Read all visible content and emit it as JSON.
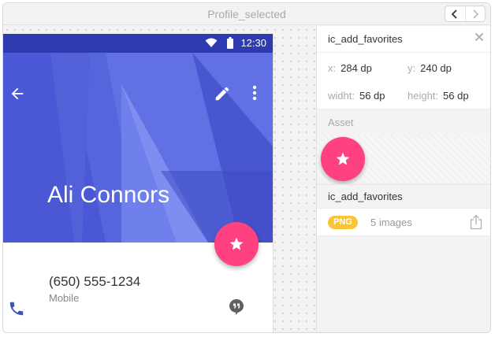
{
  "window": {
    "title": "Profile_selected"
  },
  "nav": {
    "back_icon": "chevron-left-icon",
    "forward_icon": "chevron-right-icon"
  },
  "phone": {
    "status_bar": {
      "time": "12:30",
      "color": "#2e3bb0"
    },
    "hero": {
      "name": "Ali Connors",
      "color": "#4a58d6",
      "icons": [
        "arrow-back-icon",
        "edit-icon",
        "more-vert-icon"
      ]
    },
    "fab": {
      "icon": "star-icon",
      "color": "#ff4081"
    },
    "contact": {
      "number": "(650) 555-1234",
      "label": "Mobile",
      "icons": [
        "phone-icon",
        "chat-icon"
      ]
    }
  },
  "inspector": {
    "asset_name": "ic_add_favorites",
    "x": {
      "label": "x:",
      "value": "284 dp"
    },
    "y": {
      "label": "y:",
      "value": "240 dp"
    },
    "width": {
      "label": "widht:",
      "value": "56 dp"
    },
    "height": {
      "label": "height:",
      "value": "56 dp"
    },
    "asset_heading": "Asset",
    "asset_file_name": "ic_add_favorites",
    "format_badge": "PNG",
    "image_count": "5 images",
    "badge_color": "#f8c537"
  }
}
